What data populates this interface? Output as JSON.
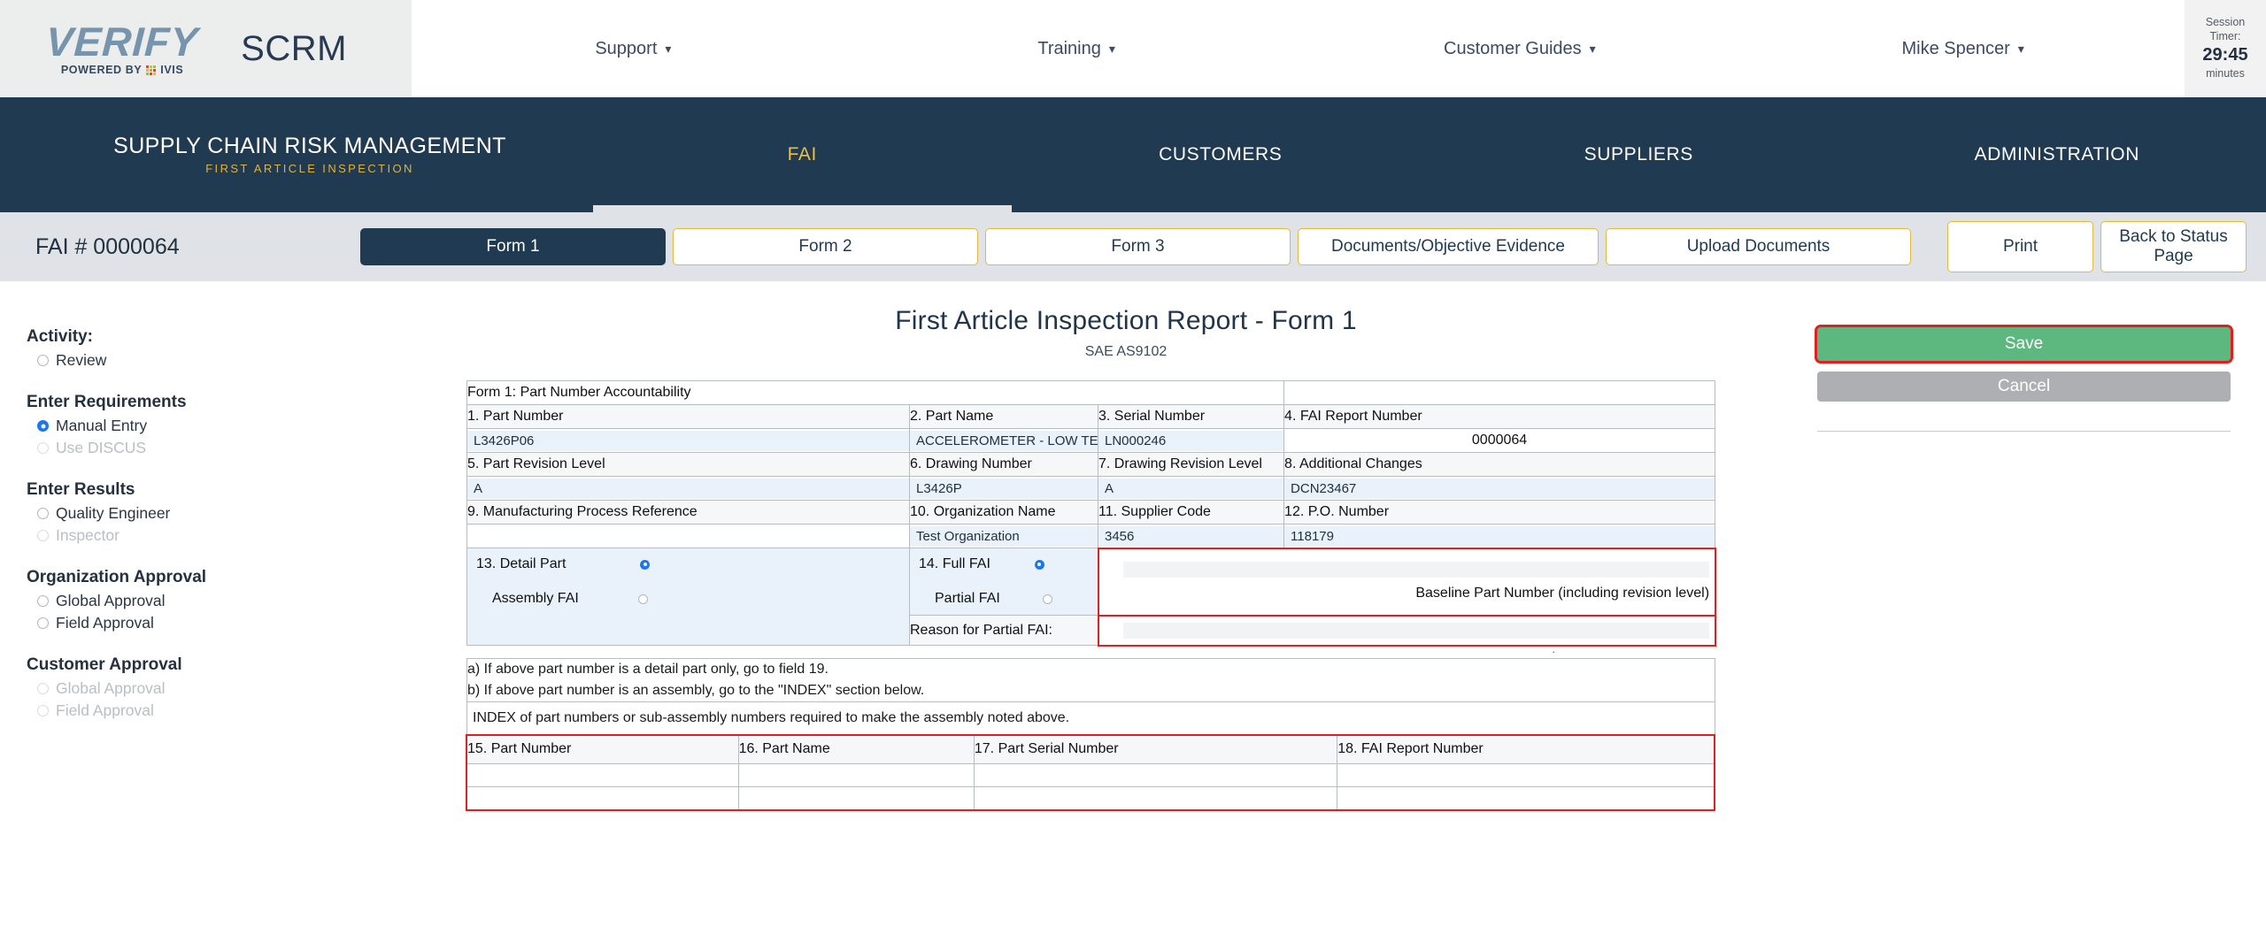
{
  "brand": {
    "logo_word": "VERIFY",
    "logo_tagline": "POWERED BY",
    "logo_partner": "IVIS",
    "product": "SCRM"
  },
  "topnav": {
    "items": [
      {
        "label": "Support",
        "icon": "chevron-down-icon"
      },
      {
        "label": "Training",
        "icon": "chevron-down-icon"
      },
      {
        "label": "Customer Guides",
        "icon": "chevron-down-icon"
      },
      {
        "label": "Mike Spencer",
        "icon": "chevron-down-icon"
      }
    ]
  },
  "session": {
    "label_line1": "Session",
    "label_line2": "Timer:",
    "time": "29:45",
    "unit": "minutes"
  },
  "navbar": {
    "title": "SUPPLY CHAIN RISK MANAGEMENT",
    "subtitle": "FIRST ARTICLE INSPECTION",
    "links": [
      {
        "label": "FAI",
        "active": true
      },
      {
        "label": "CUSTOMERS",
        "active": false
      },
      {
        "label": "SUPPLIERS",
        "active": false
      },
      {
        "label": "ADMINISTRATION",
        "active": false
      }
    ]
  },
  "tabrow": {
    "fai_number": "FAI # 0000064",
    "tabs": [
      {
        "label": "Form 1",
        "active": true
      },
      {
        "label": "Form 2",
        "active": false
      },
      {
        "label": "Form 3",
        "active": false
      },
      {
        "label": "Documents/Objective Evidence",
        "active": false
      },
      {
        "label": "Upload Documents",
        "active": false
      }
    ],
    "print_label": "Print",
    "back_label": "Back to Status Page"
  },
  "sidebar": {
    "activity_label": "Activity:",
    "groups": [
      {
        "heading": "",
        "options": [
          {
            "label": "Review",
            "selected": false,
            "disabled": false
          }
        ]
      },
      {
        "heading": "Enter Requirements",
        "options": [
          {
            "label": "Manual Entry",
            "selected": true,
            "disabled": false
          },
          {
            "label": "Use DISCUS",
            "selected": false,
            "disabled": true
          }
        ]
      },
      {
        "heading": "Enter Results",
        "options": [
          {
            "label": "Quality Engineer",
            "selected": false,
            "disabled": false
          },
          {
            "label": "Inspector",
            "selected": false,
            "disabled": true
          }
        ]
      },
      {
        "heading": "Organization Approval",
        "options": [
          {
            "label": "Global Approval",
            "selected": false,
            "disabled": false
          },
          {
            "label": "Field Approval",
            "selected": false,
            "disabled": false
          }
        ]
      },
      {
        "heading": "Customer Approval",
        "options": [
          {
            "label": "Global Approval",
            "selected": false,
            "disabled": true
          },
          {
            "label": "Field Approval",
            "selected": false,
            "disabled": true
          }
        ]
      }
    ]
  },
  "form": {
    "title": "First Article Inspection Report - Form 1",
    "subtitle": "SAE AS9102",
    "section_header": "Form 1: Part Number Accountability",
    "fields": {
      "f1_label": "1. Part Number",
      "f1_value": "L3426P06",
      "f2_label": "2. Part Name",
      "f2_value": "ACCELEROMETER - LOW TEMPE",
      "f3_label": "3. Serial Number",
      "f3_value": "LN000246",
      "f4_label": "4. FAI Report Number",
      "f4_value": "0000064",
      "f5_label": "5. Part Revision Level",
      "f5_value": "A",
      "f6_label": "6. Drawing Number",
      "f6_value": "L3426P",
      "f7_label": "7. Drawing Revision Level",
      "f7_value": "A",
      "f8_label": "8. Additional Changes",
      "f8_value": "DCN23467",
      "f9_label": "9. Manufacturing Process Reference",
      "f9_value": "",
      "f10_label": "10. Organization Name",
      "f10_value": "Test Organization",
      "f11_label": "11. Supplier Code",
      "f11_value": "3456",
      "f12_label": "12. P.O. Number",
      "f12_value": "118179"
    },
    "f13": {
      "label": "13. Detail Part",
      "detail_selected": true,
      "assembly_label": "Assembly FAI",
      "assembly_selected": false
    },
    "f14": {
      "label": "14. Full FAI",
      "full_selected": true,
      "partial_label": "Partial FAI",
      "partial_selected": false,
      "reason_label": "Reason for Partial FAI:",
      "reason_value": ""
    },
    "baseline": {
      "caption": "Baseline Part Number (including revision level)",
      "value": ""
    },
    "notes": {
      "a": "a) If above part number is a detail part only, go to field 19.",
      "b": "b) If above part number is an assembly, go to the \"INDEX\" section below.",
      "index_note": "INDEX of part numbers or sub-assembly numbers required to make the assembly noted above."
    },
    "index_table": {
      "headers": [
        "15. Part Number",
        "16. Part Name",
        "17. Part Serial Number",
        "18. FAI Report Number"
      ],
      "rows": [
        [
          "",
          "",
          "",
          ""
        ],
        [
          "",
          "",
          "",
          ""
        ]
      ]
    }
  },
  "actions": {
    "save_label": "Save",
    "cancel_label": "Cancel"
  },
  "colors": {
    "navy": "#203a51",
    "gold": "#e3b83f",
    "accent_yellow": "#f0c040",
    "save_green": "#5cb87f",
    "cancel_gray": "#adafb2",
    "highlight_red": "#e02020",
    "input_blue": "#e9f2fb",
    "radio_blue": "#1877f2"
  }
}
